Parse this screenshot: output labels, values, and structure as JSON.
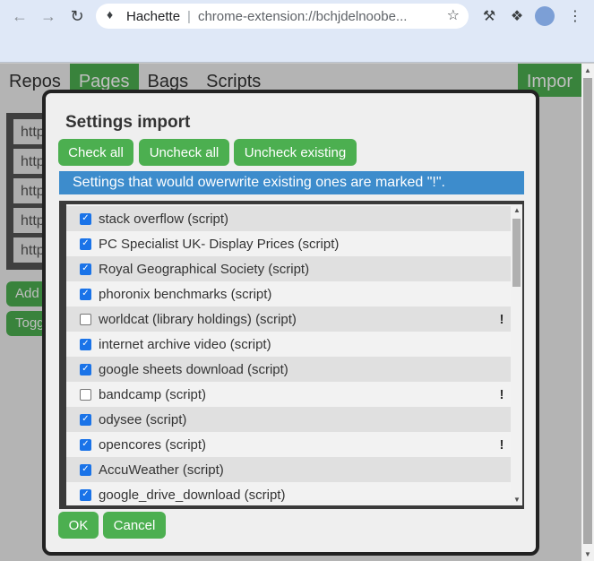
{
  "browser": {
    "site_name": "Hachette",
    "url": "chrome-extension://bchjdelnoobe..."
  },
  "app_tabs": {
    "repos": "Repos",
    "pages": "Pages",
    "bags": "Bags",
    "scripts": "Scripts",
    "import": "Impor"
  },
  "background": {
    "row_text": "http",
    "add_label": "Add",
    "toggle_label": "Togg"
  },
  "modal": {
    "title": "Settings import",
    "check_all": "Check all",
    "uncheck_all": "Uncheck all",
    "uncheck_existing": "Uncheck existing",
    "notice": "Settings that would owerwrite existing ones are marked \"!\".",
    "ok": "OK",
    "cancel": "Cancel",
    "items": [
      {
        "label": "stack overflow (script)",
        "checked": true,
        "mark": ""
      },
      {
        "label": "PC Specialist UK- Display Prices (script)",
        "checked": true,
        "mark": ""
      },
      {
        "label": "Royal Geographical Society (script)",
        "checked": true,
        "mark": ""
      },
      {
        "label": "phoronix benchmarks (script)",
        "checked": true,
        "mark": ""
      },
      {
        "label": "worldcat (library holdings) (script)",
        "checked": false,
        "mark": "!"
      },
      {
        "label": "internet archive video (script)",
        "checked": true,
        "mark": ""
      },
      {
        "label": "google sheets download (script)",
        "checked": true,
        "mark": ""
      },
      {
        "label": "bandcamp (script)",
        "checked": false,
        "mark": "!"
      },
      {
        "label": "odysee (script)",
        "checked": true,
        "mark": ""
      },
      {
        "label": "opencores (script)",
        "checked": true,
        "mark": "!"
      },
      {
        "label": "AccuWeather (script)",
        "checked": true,
        "mark": ""
      },
      {
        "label": "google_drive_download (script)",
        "checked": true,
        "mark": ""
      }
    ]
  },
  "colors": {
    "accent": "#4caf50",
    "notice": "#3d8ccc",
    "checkbox": "#1a73e8"
  }
}
